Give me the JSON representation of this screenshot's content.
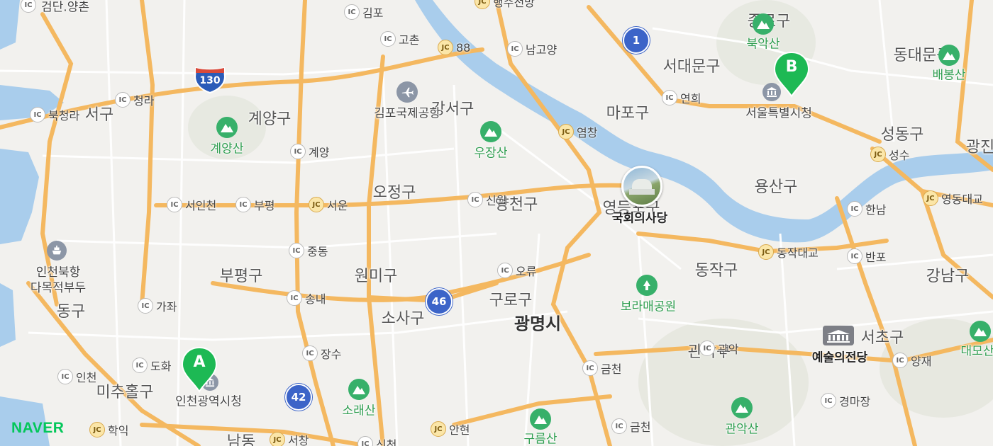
{
  "colors": {
    "land": "#f2f1ee",
    "water": "#a9cdec",
    "road_major": "#f4b860",
    "road_minor": "#ffffff",
    "park": "#37b06a",
    "marker": "#1db954",
    "shield": "#3c64c8",
    "naver": "#03c75a"
  },
  "brand": "NAVER",
  "districts": [
    "검단.양촌",
    "서구",
    "계양구",
    "강서구",
    "오정구",
    "양천구",
    "부평구",
    "원미구",
    "소사구",
    "구로구",
    "동구",
    "미추홀구",
    "남동",
    "서대문구",
    "종로구",
    "마포구",
    "영등포구",
    "용산구",
    "동대문구",
    "성동구",
    "광진",
    "동작구",
    "관악구",
    "서초구",
    "강남구"
  ],
  "cities": [
    "광명시"
  ],
  "pois": [
    {
      "name": "김포국제공항",
      "icon": "airplane-icon"
    },
    {
      "name": "국회의사당",
      "icon": "photo-thumbnail"
    },
    {
      "name": "서울특별시청",
      "icon": "government-icon"
    },
    {
      "name": "인천광역시청",
      "icon": "government-icon"
    },
    {
      "name": "인천북항\n다목적부두",
      "icon": "port-icon"
    },
    {
      "name": "예술의전당",
      "icon": "theater-icon"
    }
  ],
  "parks": [
    "계양산",
    "우장산",
    "북악산",
    "배봉산",
    "보라매공원",
    "소래산",
    "구름산",
    "관악산",
    "대모산"
  ],
  "interchanges": [
    {
      "type": "IC",
      "name": "검단.양촌"
    },
    {
      "type": "IC",
      "name": "김포"
    },
    {
      "type": "JC",
      "name": "행주전망"
    },
    {
      "type": "IC",
      "name": "고촌"
    },
    {
      "type": "JC",
      "name": "88"
    },
    {
      "type": "IC",
      "name": "남고양"
    },
    {
      "type": "IC",
      "name": "청라"
    },
    {
      "type": "IC",
      "name": "북청라"
    },
    {
      "type": "IC",
      "name": "계양"
    },
    {
      "type": "IC",
      "name": "연희"
    },
    {
      "type": "JC",
      "name": "염창"
    },
    {
      "type": "JC",
      "name": "성수"
    },
    {
      "type": "IC",
      "name": "서인천"
    },
    {
      "type": "IC",
      "name": "부평"
    },
    {
      "type": "JC",
      "name": "서운"
    },
    {
      "type": "IC",
      "name": "신월"
    },
    {
      "type": "IC",
      "name": "한남"
    },
    {
      "type": "JC",
      "name": "영동대교"
    },
    {
      "type": "IC",
      "name": "중동"
    },
    {
      "type": "JC",
      "name": "동작대교"
    },
    {
      "type": "IC",
      "name": "반포"
    },
    {
      "type": "IC",
      "name": "오류"
    },
    {
      "type": "IC",
      "name": "송내"
    },
    {
      "type": "IC",
      "name": "가좌"
    },
    {
      "type": "IC",
      "name": "관악"
    },
    {
      "type": "IC",
      "name": "장수"
    },
    {
      "type": "IC",
      "name": "금천"
    },
    {
      "type": "IC",
      "name": "양재"
    },
    {
      "type": "IC",
      "name": "도화"
    },
    {
      "type": "IC",
      "name": "인천"
    },
    {
      "type": "IC",
      "name": "경마장"
    },
    {
      "type": "JC",
      "name": "학익"
    },
    {
      "type": "JC",
      "name": "서창"
    },
    {
      "type": "IC",
      "name": "신천"
    },
    {
      "type": "JC",
      "name": "안현"
    },
    {
      "type": "IC",
      "name": "금천"
    }
  ],
  "shields": [
    {
      "type": "national",
      "number": "1"
    },
    {
      "type": "national",
      "number": "46"
    },
    {
      "type": "national",
      "number": "42"
    },
    {
      "type": "interstate",
      "number": "130"
    }
  ],
  "markers": [
    {
      "letter": "A",
      "label": "인천광역시청"
    },
    {
      "letter": "B",
      "label": "서울특별시청"
    }
  ]
}
